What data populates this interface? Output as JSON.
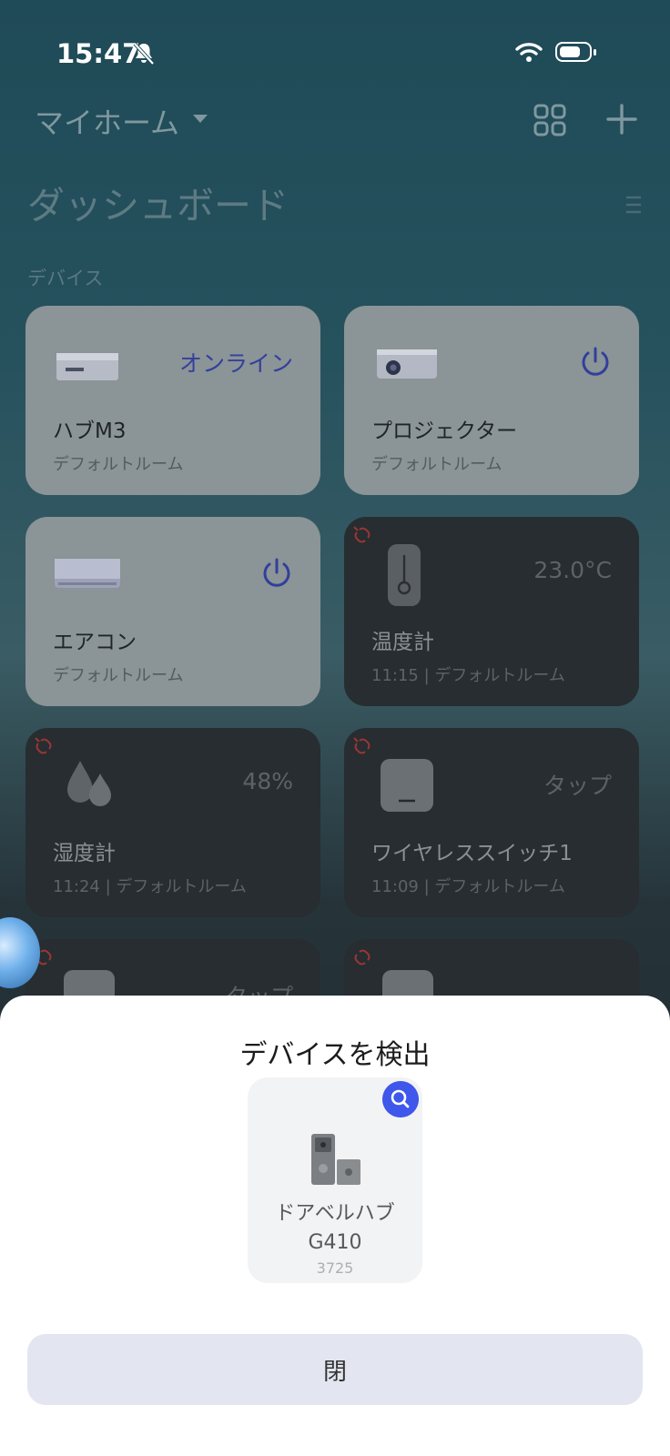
{
  "status_bar": {
    "time": "15:47"
  },
  "header": {
    "home_name": "マイホーム",
    "dashboard_title": "ダッシュボード",
    "section_label": "デバイス"
  },
  "devices": [
    {
      "name": "ハブM3",
      "sub": "デフォルトルーム",
      "status": "オンライン",
      "icon": "hub-device-icon"
    },
    {
      "name": "プロジェクター",
      "sub": "デフォルトルーム",
      "icon": "projector-icon"
    },
    {
      "name": "エアコン",
      "sub": "デフォルトルーム",
      "icon": "air-conditioner-icon"
    },
    {
      "name": "温度計",
      "sub": "11:15 | デフォルトルーム",
      "value": "23.0°C",
      "icon": "thermometer-icon"
    },
    {
      "name": "湿度計",
      "sub": "11:24 | デフォルトルーム",
      "value": "48%",
      "icon": "humidity-drops-icon"
    },
    {
      "name": "ワイヤレススイッチ1",
      "sub": "11:09 | デフォルトルーム",
      "value": "タップ",
      "icon": "wireless-switch-icon"
    },
    {
      "value": "タップ"
    }
  ],
  "sheet": {
    "title": "デバイスを検出",
    "found_device": {
      "name_line1": "ドアベルハブ",
      "name_line2": "G410",
      "code": "3725"
    },
    "close_label": "閉"
  },
  "colors": {
    "accent": "#3f57ea",
    "offline_link": "#c03a3a",
    "close_button_bg": "#e3e6f0"
  }
}
